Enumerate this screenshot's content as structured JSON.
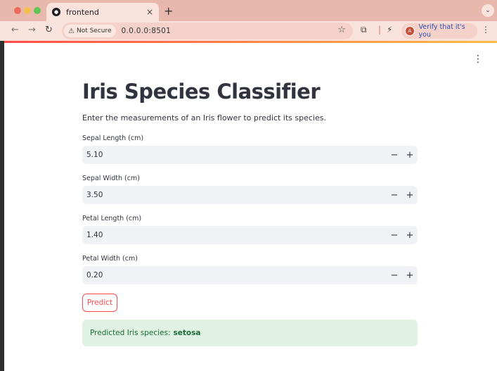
{
  "browser": {
    "tab_title": "frontend",
    "tab_close": "×",
    "new_tab": "+",
    "security_label": "Not Secure",
    "url": "0.0.0.0:8501",
    "profile_avatar": "A",
    "profile_text": "Verify that it's you"
  },
  "app": {
    "title": "Iris Species Classifier",
    "subtitle": "Enter the measurements of an Iris flower to predict its species.",
    "fields": [
      {
        "label": "Sepal Length (cm)",
        "value": "5.10"
      },
      {
        "label": "Sepal Width (cm)",
        "value": "3.50"
      },
      {
        "label": "Petal Length (cm)",
        "value": "1.40"
      },
      {
        "label": "Petal Width (cm)",
        "value": "0.20"
      }
    ],
    "decrement": "−",
    "increment": "+",
    "predict_label": "Predict",
    "result_prefix": "Predicted Iris species:",
    "result_value": "setosa"
  },
  "colors": {
    "accent": "#ff4b4b",
    "success_bg": "#dff2e3",
    "success_text": "#1c6b3a",
    "chrome_bg": "#fbe3dd"
  },
  "icons": [
    "back-icon",
    "forward-icon",
    "reload-icon",
    "warning-icon",
    "star-icon",
    "extensions-icon",
    "performance-icon",
    "kebab-menu-icon"
  ]
}
